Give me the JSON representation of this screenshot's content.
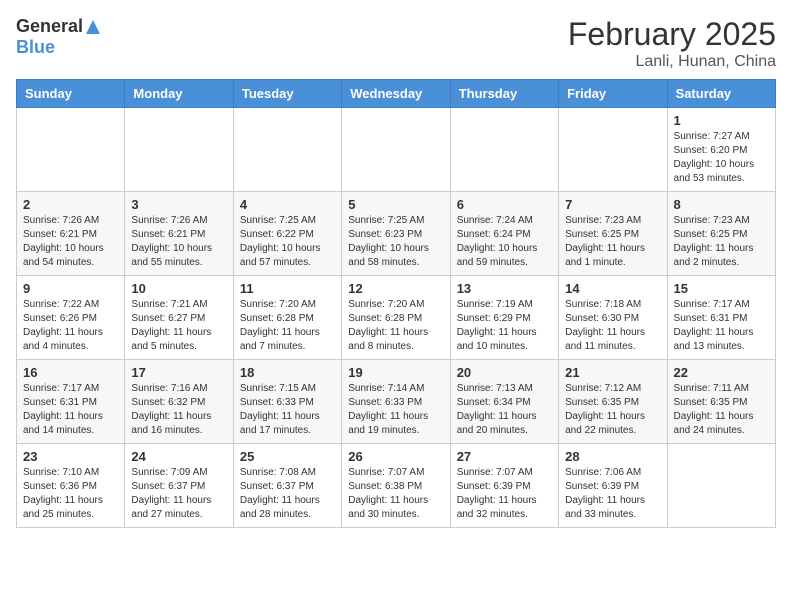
{
  "header": {
    "logo_general": "General",
    "logo_blue": "Blue",
    "month_title": "February 2025",
    "location": "Lanli, Hunan, China"
  },
  "weekdays": [
    "Sunday",
    "Monday",
    "Tuesday",
    "Wednesday",
    "Thursday",
    "Friday",
    "Saturday"
  ],
  "weeks": [
    [
      {
        "day": "",
        "info": ""
      },
      {
        "day": "",
        "info": ""
      },
      {
        "day": "",
        "info": ""
      },
      {
        "day": "",
        "info": ""
      },
      {
        "day": "",
        "info": ""
      },
      {
        "day": "",
        "info": ""
      },
      {
        "day": "1",
        "info": "Sunrise: 7:27 AM\nSunset: 6:20 PM\nDaylight: 10 hours\nand 53 minutes."
      }
    ],
    [
      {
        "day": "2",
        "info": "Sunrise: 7:26 AM\nSunset: 6:21 PM\nDaylight: 10 hours\nand 54 minutes."
      },
      {
        "day": "3",
        "info": "Sunrise: 7:26 AM\nSunset: 6:21 PM\nDaylight: 10 hours\nand 55 minutes."
      },
      {
        "day": "4",
        "info": "Sunrise: 7:25 AM\nSunset: 6:22 PM\nDaylight: 10 hours\nand 57 minutes."
      },
      {
        "day": "5",
        "info": "Sunrise: 7:25 AM\nSunset: 6:23 PM\nDaylight: 10 hours\nand 58 minutes."
      },
      {
        "day": "6",
        "info": "Sunrise: 7:24 AM\nSunset: 6:24 PM\nDaylight: 10 hours\nand 59 minutes."
      },
      {
        "day": "7",
        "info": "Sunrise: 7:23 AM\nSunset: 6:25 PM\nDaylight: 11 hours\nand 1 minute."
      },
      {
        "day": "8",
        "info": "Sunrise: 7:23 AM\nSunset: 6:25 PM\nDaylight: 11 hours\nand 2 minutes."
      }
    ],
    [
      {
        "day": "9",
        "info": "Sunrise: 7:22 AM\nSunset: 6:26 PM\nDaylight: 11 hours\nand 4 minutes."
      },
      {
        "day": "10",
        "info": "Sunrise: 7:21 AM\nSunset: 6:27 PM\nDaylight: 11 hours\nand 5 minutes."
      },
      {
        "day": "11",
        "info": "Sunrise: 7:20 AM\nSunset: 6:28 PM\nDaylight: 11 hours\nand 7 minutes."
      },
      {
        "day": "12",
        "info": "Sunrise: 7:20 AM\nSunset: 6:28 PM\nDaylight: 11 hours\nand 8 minutes."
      },
      {
        "day": "13",
        "info": "Sunrise: 7:19 AM\nSunset: 6:29 PM\nDaylight: 11 hours\nand 10 minutes."
      },
      {
        "day": "14",
        "info": "Sunrise: 7:18 AM\nSunset: 6:30 PM\nDaylight: 11 hours\nand 11 minutes."
      },
      {
        "day": "15",
        "info": "Sunrise: 7:17 AM\nSunset: 6:31 PM\nDaylight: 11 hours\nand 13 minutes."
      }
    ],
    [
      {
        "day": "16",
        "info": "Sunrise: 7:17 AM\nSunset: 6:31 PM\nDaylight: 11 hours\nand 14 minutes."
      },
      {
        "day": "17",
        "info": "Sunrise: 7:16 AM\nSunset: 6:32 PM\nDaylight: 11 hours\nand 16 minutes."
      },
      {
        "day": "18",
        "info": "Sunrise: 7:15 AM\nSunset: 6:33 PM\nDaylight: 11 hours\nand 17 minutes."
      },
      {
        "day": "19",
        "info": "Sunrise: 7:14 AM\nSunset: 6:33 PM\nDaylight: 11 hours\nand 19 minutes."
      },
      {
        "day": "20",
        "info": "Sunrise: 7:13 AM\nSunset: 6:34 PM\nDaylight: 11 hours\nand 20 minutes."
      },
      {
        "day": "21",
        "info": "Sunrise: 7:12 AM\nSunset: 6:35 PM\nDaylight: 11 hours\nand 22 minutes."
      },
      {
        "day": "22",
        "info": "Sunrise: 7:11 AM\nSunset: 6:35 PM\nDaylight: 11 hours\nand 24 minutes."
      }
    ],
    [
      {
        "day": "23",
        "info": "Sunrise: 7:10 AM\nSunset: 6:36 PM\nDaylight: 11 hours\nand 25 minutes."
      },
      {
        "day": "24",
        "info": "Sunrise: 7:09 AM\nSunset: 6:37 PM\nDaylight: 11 hours\nand 27 minutes."
      },
      {
        "day": "25",
        "info": "Sunrise: 7:08 AM\nSunset: 6:37 PM\nDaylight: 11 hours\nand 28 minutes."
      },
      {
        "day": "26",
        "info": "Sunrise: 7:07 AM\nSunset: 6:38 PM\nDaylight: 11 hours\nand 30 minutes."
      },
      {
        "day": "27",
        "info": "Sunrise: 7:07 AM\nSunset: 6:39 PM\nDaylight: 11 hours\nand 32 minutes."
      },
      {
        "day": "28",
        "info": "Sunrise: 7:06 AM\nSunset: 6:39 PM\nDaylight: 11 hours\nand 33 minutes."
      },
      {
        "day": "",
        "info": ""
      }
    ]
  ]
}
